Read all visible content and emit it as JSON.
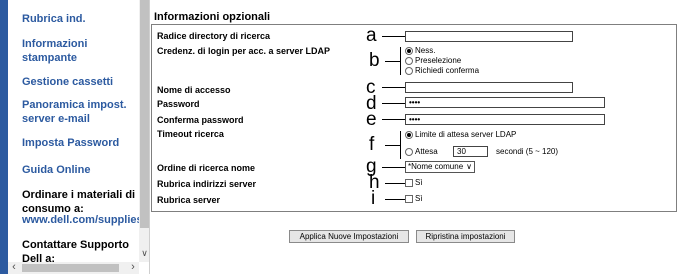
{
  "sidebar": {
    "links": [
      "Rubrica ind.",
      "Informazioni stampante",
      "Gestione cassetti",
      "Panoramica impost. server e-mail",
      "Imposta Password",
      "Guida Online"
    ],
    "order_heading": "Ordinare i materiali di consumo a:",
    "order_url": "www.dell.com/supplies",
    "support_heading": "Contattare Supporto Dell a:"
  },
  "form": {
    "title": "Informazioni opzionali",
    "labels": {
      "search_root": "Radice directory di ricerca",
      "login_credentials": "Credenz. di login per acc. a server LDAP",
      "login_name": "Nome di accesso",
      "password": "Password",
      "confirm_password": "Conferma password",
      "search_timeout": "Timeout ricerca",
      "name_search_order": "Ordine di ricerca nome",
      "server_address_book": "Rubrica indirizzi server",
      "server_phonebook": "Rubrica server"
    },
    "credential_options": [
      "Ness.",
      "Preselezione",
      "Richiedi conferma"
    ],
    "credential_selected": "Ness.",
    "password_mask": "••••",
    "confirm_mask": "••••",
    "timeout_options": {
      "server_limit": "Limite di attesa server LDAP",
      "wait": "Attesa",
      "wait_value": "30",
      "unit": "secondi (5 ~ 120)"
    },
    "name_order_value": "*Nome comune",
    "checkbox_label": "Sì",
    "buttons": {
      "apply": "Applica Nuove Impostazioni",
      "reset": "Ripristina impostazioni"
    }
  },
  "callouts": [
    "a",
    "b",
    "c",
    "d",
    "e",
    "f",
    "g",
    "h",
    "i"
  ]
}
